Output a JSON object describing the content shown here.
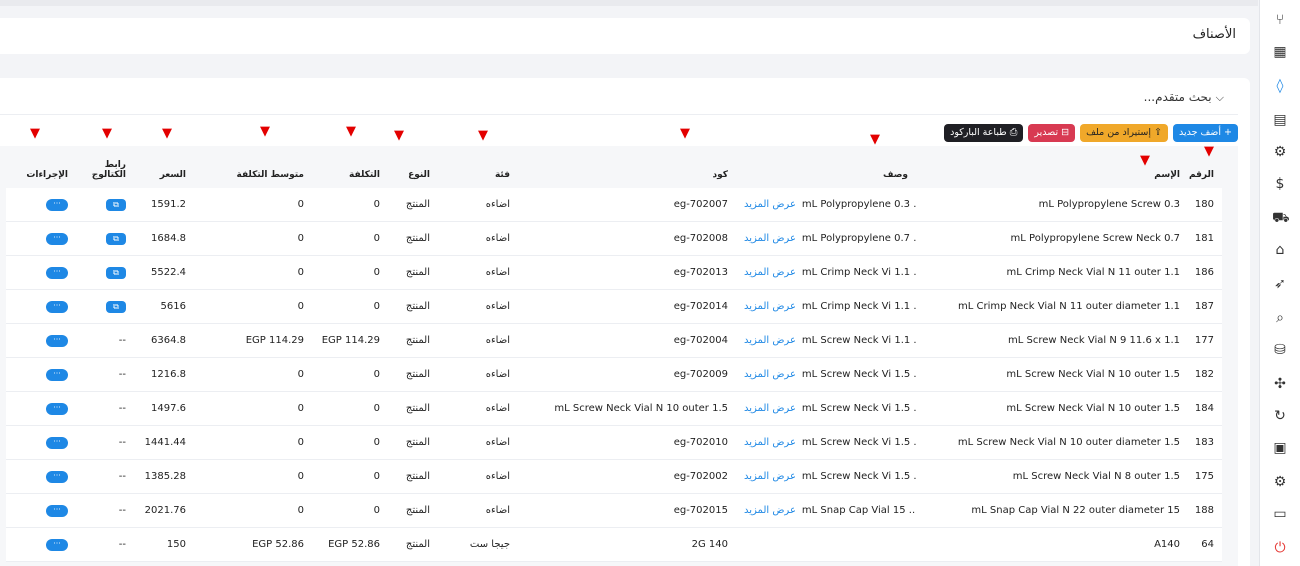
{
  "page": {
    "title": "الأصناف"
  },
  "search": {
    "toggle_label": "بحث متقدم..."
  },
  "toolbar": {
    "add_label": "+ أضف جديد",
    "import_label": "⇪ إستيراد من ملف",
    "export_label": "⊟ تصدير",
    "print_label": "⎙ طباعة الباركود"
  },
  "sidebar": {
    "icons": [
      "git-branch-icon",
      "map-icon",
      "drop-icon",
      "invoice-icon",
      "settings-doc-icon",
      "currency-icon",
      "truck-icon",
      "tag-icon",
      "rocket-icon",
      "search-doc-icon",
      "database-icon",
      "puzzle-icon",
      "refresh-icon",
      "payment-icon",
      "gear-icon",
      "monitor-icon",
      "power-icon"
    ]
  },
  "table": {
    "headers": {
      "number": "الرقم",
      "name": "الإسم",
      "description": "وصف",
      "code": "كود",
      "category": "فئة",
      "type": "النوع",
      "cost": "التكلفة",
      "avg_cost": "متوسط التكلفة",
      "price": "السعر",
      "catalog": "رابط الكتالوج",
      "actions": "الإجراءات"
    },
    "more_label": "عرض المزيد",
    "actions_label": "···",
    "rows": [
      {
        "number": "180",
        "name": "mL Polypropylene Screw 0.3",
        "description": "mL Polypropylene 0.3 ...",
        "more": true,
        "code": "eg-702007",
        "category": "اضاءه",
        "type": "المنتج",
        "cost": "0",
        "avg_cost": "0",
        "price": "1591.2",
        "catalog": "icon"
      },
      {
        "number": "181",
        "name": "mL Polypropylene Screw Neck 0.7",
        "description": "mL Polypropylene 0.7 ...",
        "more": true,
        "code": "eg-702008",
        "category": "اضاءه",
        "type": "المنتج",
        "cost": "0",
        "avg_cost": "0",
        "price": "1684.8",
        "catalog": "icon"
      },
      {
        "number": "186",
        "name": "mL Crimp Neck Vial N 11 outer 1.1",
        "description": "mL Crimp Neck Vi 1.1 ...",
        "more": true,
        "code": "eg-702013",
        "category": "اضاءه",
        "type": "المنتج",
        "cost": "0",
        "avg_cost": "0",
        "price": "5522.4",
        "catalog": "icon"
      },
      {
        "number": "187",
        "name": "mL Crimp Neck Vial N 11 outer diameter 1.1",
        "description": "mL Crimp Neck Vi 1.1 ...",
        "more": true,
        "code": "eg-702014",
        "category": "اضاءه",
        "type": "المنتج",
        "cost": "0",
        "avg_cost": "0",
        "price": "5616",
        "catalog": "icon"
      },
      {
        "number": "177",
        "name": "mL Screw Neck Vial N 9 11.6 x 1.1",
        "description": "mL Screw Neck Vi 1.1 ...",
        "more": true,
        "code": "eg-702004",
        "category": "اضاءه",
        "type": "المنتج",
        "cost": "EGP 114.29",
        "avg_cost": "EGP 114.29",
        "price": "6364.8",
        "catalog": "--"
      },
      {
        "number": "182",
        "name": "mL Screw Neck Vial N 10 outer 1.5",
        "description": "mL Screw Neck Vi 1.5 ...",
        "more": true,
        "code": "eg-702009",
        "category": "اضاءه",
        "type": "المنتج",
        "cost": "0",
        "avg_cost": "0",
        "price": "1216.8",
        "catalog": "--"
      },
      {
        "number": "184",
        "name": "mL Screw Neck Vial N 10 outer 1.5",
        "description": "mL Screw Neck Vi 1.5 ...",
        "more": true,
        "code": "mL Screw Neck Vial N 10 outer 1.5",
        "category": "اضاءه",
        "type": "المنتج",
        "cost": "0",
        "avg_cost": "0",
        "price": "1497.6",
        "catalog": "--"
      },
      {
        "number": "183",
        "name": "mL Screw Neck Vial N 10 outer diameter 1.5",
        "description": "mL Screw Neck Vi 1.5 ...",
        "more": true,
        "code": "eg-702010",
        "category": "اضاءه",
        "type": "المنتج",
        "cost": "0",
        "avg_cost": "0",
        "price": "1441.44",
        "catalog": "--"
      },
      {
        "number": "175",
        "name": "mL Screw Neck Vial N 8 outer 1.5",
        "description": "mL Screw Neck Vi 1.5 ...",
        "more": true,
        "code": "eg-702002",
        "category": "اضاءه",
        "type": "المنتج",
        "cost": "0",
        "avg_cost": "0",
        "price": "1385.28",
        "catalog": "--"
      },
      {
        "number": "188",
        "name": "mL Snap Cap Vial N 22 outer diameter 15",
        "description": "mL Snap Cap Vial 15 ...",
        "more": true,
        "code": "eg-702015",
        "category": "اضاءه",
        "type": "المنتج",
        "cost": "0",
        "avg_cost": "0",
        "price": "2021.76",
        "catalog": "--"
      },
      {
        "number": "64",
        "name": "A140",
        "description": "",
        "more": false,
        "code": "2G 140",
        "category": "جيجا ست",
        "type": "المنتج",
        "cost": "EGP 52.86",
        "avg_cost": "EGP 52.86",
        "price": "150",
        "catalog": "--"
      }
    ]
  },
  "colors": {
    "accent": "#1e88e5",
    "warning": "#f0a82a",
    "danger": "#d83a52",
    "dark": "#1f1f24",
    "arrow": "#e30000"
  }
}
